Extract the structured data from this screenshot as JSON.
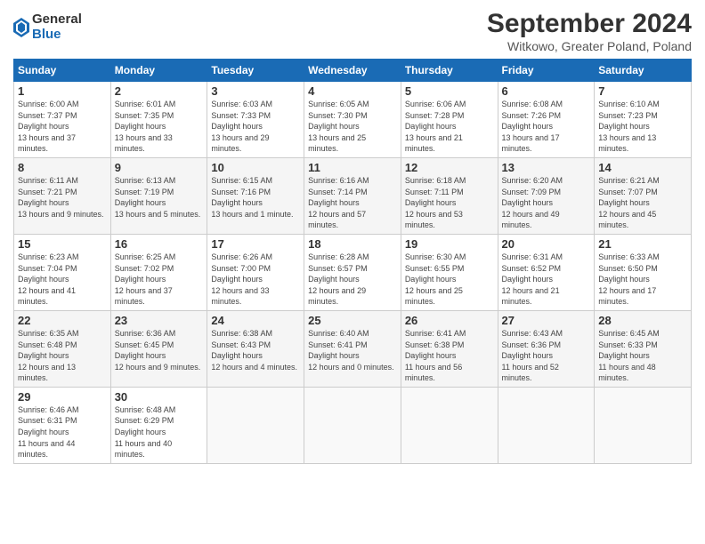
{
  "header": {
    "logo_general": "General",
    "logo_blue": "Blue",
    "month_title": "September 2024",
    "location": "Witkowo, Greater Poland, Poland"
  },
  "days_of_week": [
    "Sunday",
    "Monday",
    "Tuesday",
    "Wednesday",
    "Thursday",
    "Friday",
    "Saturday"
  ],
  "weeks": [
    [
      {
        "day": "1",
        "sunrise": "6:00 AM",
        "sunset": "7:37 PM",
        "daylight": "13 hours and 37 minutes."
      },
      {
        "day": "2",
        "sunrise": "6:01 AM",
        "sunset": "7:35 PM",
        "daylight": "13 hours and 33 minutes."
      },
      {
        "day": "3",
        "sunrise": "6:03 AM",
        "sunset": "7:33 PM",
        "daylight": "13 hours and 29 minutes."
      },
      {
        "day": "4",
        "sunrise": "6:05 AM",
        "sunset": "7:30 PM",
        "daylight": "13 hours and 25 minutes."
      },
      {
        "day": "5",
        "sunrise": "6:06 AM",
        "sunset": "7:28 PM",
        "daylight": "13 hours and 21 minutes."
      },
      {
        "day": "6",
        "sunrise": "6:08 AM",
        "sunset": "7:26 PM",
        "daylight": "13 hours and 17 minutes."
      },
      {
        "day": "7",
        "sunrise": "6:10 AM",
        "sunset": "7:23 PM",
        "daylight": "13 hours and 13 minutes."
      }
    ],
    [
      {
        "day": "8",
        "sunrise": "6:11 AM",
        "sunset": "7:21 PM",
        "daylight": "13 hours and 9 minutes."
      },
      {
        "day": "9",
        "sunrise": "6:13 AM",
        "sunset": "7:19 PM",
        "daylight": "13 hours and 5 minutes."
      },
      {
        "day": "10",
        "sunrise": "6:15 AM",
        "sunset": "7:16 PM",
        "daylight": "13 hours and 1 minute."
      },
      {
        "day": "11",
        "sunrise": "6:16 AM",
        "sunset": "7:14 PM",
        "daylight": "12 hours and 57 minutes."
      },
      {
        "day": "12",
        "sunrise": "6:18 AM",
        "sunset": "7:11 PM",
        "daylight": "12 hours and 53 minutes."
      },
      {
        "day": "13",
        "sunrise": "6:20 AM",
        "sunset": "7:09 PM",
        "daylight": "12 hours and 49 minutes."
      },
      {
        "day": "14",
        "sunrise": "6:21 AM",
        "sunset": "7:07 PM",
        "daylight": "12 hours and 45 minutes."
      }
    ],
    [
      {
        "day": "15",
        "sunrise": "6:23 AM",
        "sunset": "7:04 PM",
        "daylight": "12 hours and 41 minutes."
      },
      {
        "day": "16",
        "sunrise": "6:25 AM",
        "sunset": "7:02 PM",
        "daylight": "12 hours and 37 minutes."
      },
      {
        "day": "17",
        "sunrise": "6:26 AM",
        "sunset": "7:00 PM",
        "daylight": "12 hours and 33 minutes."
      },
      {
        "day": "18",
        "sunrise": "6:28 AM",
        "sunset": "6:57 PM",
        "daylight": "12 hours and 29 minutes."
      },
      {
        "day": "19",
        "sunrise": "6:30 AM",
        "sunset": "6:55 PM",
        "daylight": "12 hours and 25 minutes."
      },
      {
        "day": "20",
        "sunrise": "6:31 AM",
        "sunset": "6:52 PM",
        "daylight": "12 hours and 21 minutes."
      },
      {
        "day": "21",
        "sunrise": "6:33 AM",
        "sunset": "6:50 PM",
        "daylight": "12 hours and 17 minutes."
      }
    ],
    [
      {
        "day": "22",
        "sunrise": "6:35 AM",
        "sunset": "6:48 PM",
        "daylight": "12 hours and 13 minutes."
      },
      {
        "day": "23",
        "sunrise": "6:36 AM",
        "sunset": "6:45 PM",
        "daylight": "12 hours and 9 minutes."
      },
      {
        "day": "24",
        "sunrise": "6:38 AM",
        "sunset": "6:43 PM",
        "daylight": "12 hours and 4 minutes."
      },
      {
        "day": "25",
        "sunrise": "6:40 AM",
        "sunset": "6:41 PM",
        "daylight": "12 hours and 0 minutes."
      },
      {
        "day": "26",
        "sunrise": "6:41 AM",
        "sunset": "6:38 PM",
        "daylight": "11 hours and 56 minutes."
      },
      {
        "day": "27",
        "sunrise": "6:43 AM",
        "sunset": "6:36 PM",
        "daylight": "11 hours and 52 minutes."
      },
      {
        "day": "28",
        "sunrise": "6:45 AM",
        "sunset": "6:33 PM",
        "daylight": "11 hours and 48 minutes."
      }
    ],
    [
      {
        "day": "29",
        "sunrise": "6:46 AM",
        "sunset": "6:31 PM",
        "daylight": "11 hours and 44 minutes."
      },
      {
        "day": "30",
        "sunrise": "6:48 AM",
        "sunset": "6:29 PM",
        "daylight": "11 hours and 40 minutes."
      },
      null,
      null,
      null,
      null,
      null
    ]
  ]
}
